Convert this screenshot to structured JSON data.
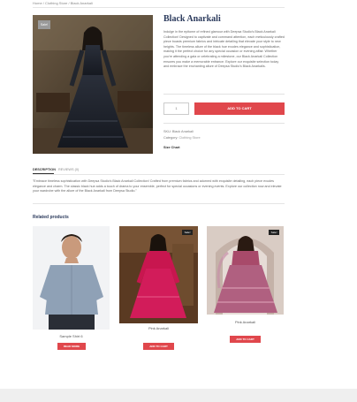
{
  "breadcrumb": "Home / Clothing Store / Black Anarkali",
  "product": {
    "title": "Black Anarkali",
    "sale_badge": "Sale!",
    "description": "Indulge in the epitome of refined glamour with Deepsa Studio's Black Anarkali Collection! Designed to captivate and command attention, each meticulously crafted piece boasts premium fabrics and intricate detailing that elevate your style to new heights. The timeless allure of the black hue exudes elegance and sophistication, making it the perfect choice for any special occasion or evening affair. Whether you're attending a gala or celebrating a milestone, our Black Anarkali Collection ensures you make a memorable entrance. Explore our exquisite selection today and embrace the enchanting allure of Deepsa Studio's Black Anarkalis.",
    "quantity": "1",
    "add_to_cart": "ADD TO CART",
    "sku": "SKU: Black Anarkali",
    "category_label": "Category:",
    "category_value": "Clothing Store",
    "size_chart": "Size Chart"
  },
  "tabs": {
    "description": "DESCRIPTION",
    "reviews": "REVIEWS (0)"
  },
  "long_description": "\"Embrace timeless sophistication with Deepsa Studio's Black Anarkali Collection! Crafted from premium fabrics and adorned with exquisite detailing, each piece exudes elegance and charm. The classic black hue adds a touch of drama to your ensemble, perfect for special occasions or evening events. Explore our collection now and elevate your wardrobe with the allure of the Black Anarkali from Deepsa Studio.\"",
  "related": {
    "heading": "Related products",
    "items": [
      {
        "title": "Sample Shirt 6",
        "button": "READ MORE",
        "badge": ""
      },
      {
        "title": "Pink Anarkali",
        "button": "ADD TO CART",
        "badge": "Sale!"
      },
      {
        "title": "Pink Anarkali",
        "button": "ADD TO CART",
        "badge": "Sale!"
      }
    ]
  },
  "colors": {
    "accent": "#e0474c",
    "heading": "#2b3a5c"
  }
}
